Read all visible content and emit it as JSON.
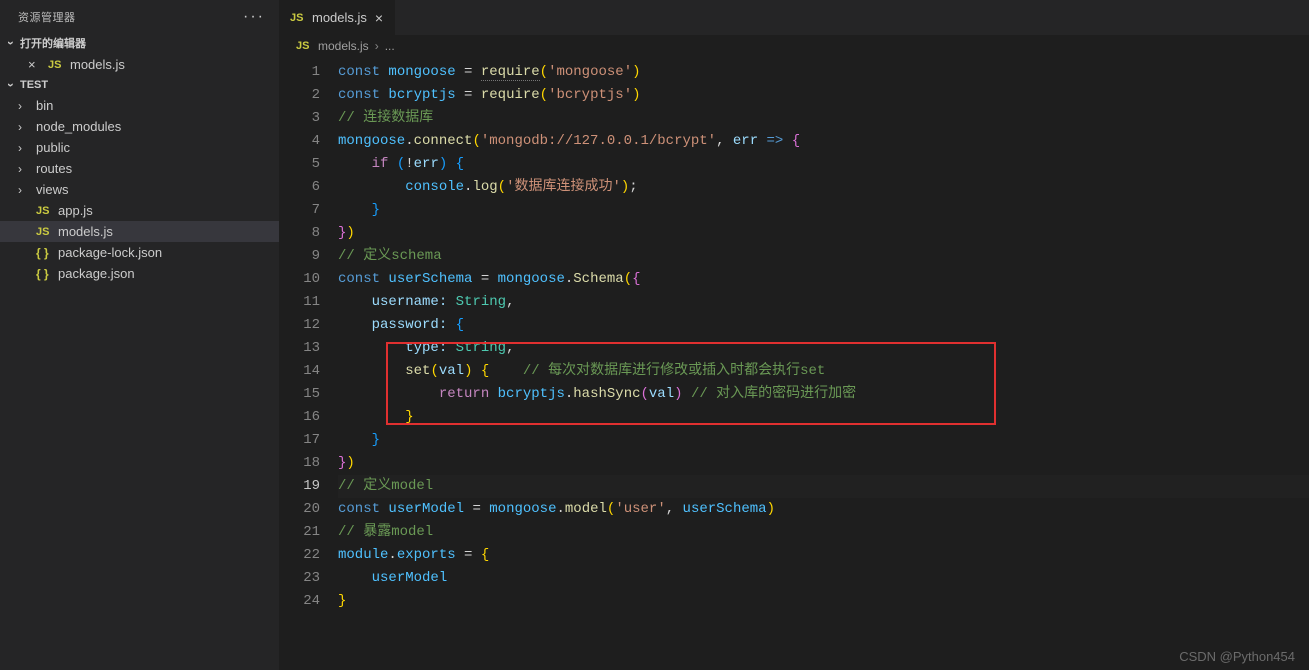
{
  "sidebar": {
    "title": "资源管理器",
    "open_editors_label": "打开的编辑器",
    "open_editors": [
      {
        "icon": "JS",
        "name": "models.js"
      }
    ],
    "root_label": "TEST",
    "tree": [
      {
        "type": "folder",
        "name": "bin"
      },
      {
        "type": "folder",
        "name": "node_modules"
      },
      {
        "type": "folder",
        "name": "public"
      },
      {
        "type": "folder",
        "name": "routes"
      },
      {
        "type": "folder",
        "name": "views"
      },
      {
        "type": "file",
        "icon": "JS",
        "name": "app.js"
      },
      {
        "type": "file",
        "icon": "JS",
        "name": "models.js",
        "active": true
      },
      {
        "type": "file",
        "icon": "{}",
        "name": "package-lock.json"
      },
      {
        "type": "file",
        "icon": "{}",
        "name": "package.json"
      }
    ]
  },
  "tab": {
    "icon": "JS",
    "name": "models.js"
  },
  "breadcrumb": {
    "icon": "JS",
    "file": "models.js",
    "dots": "..."
  },
  "code": {
    "lines": [
      [
        {
          "t": "const ",
          "c": "k-const"
        },
        {
          "t": "mongoose",
          "c": "k-var"
        },
        {
          "t": " = ",
          "c": "k-punc"
        },
        {
          "t": "require",
          "c": "k-func dotted"
        },
        {
          "t": "(",
          "c": "k-brace-y"
        },
        {
          "t": "'mongoose'",
          "c": "k-str"
        },
        {
          "t": ")",
          "c": "k-brace-y"
        }
      ],
      [
        {
          "t": "const ",
          "c": "k-const"
        },
        {
          "t": "bcryptjs",
          "c": "k-var"
        },
        {
          "t": " = ",
          "c": "k-punc"
        },
        {
          "t": "require",
          "c": "k-func"
        },
        {
          "t": "(",
          "c": "k-brace-y"
        },
        {
          "t": "'bcryptjs'",
          "c": "k-str"
        },
        {
          "t": ")",
          "c": "k-brace-y"
        }
      ],
      [
        {
          "t": "// 连接数据库",
          "c": "k-comment"
        }
      ],
      [
        {
          "t": "mongoose",
          "c": "k-var"
        },
        {
          "t": ".",
          "c": "k-punc"
        },
        {
          "t": "connect",
          "c": "k-func"
        },
        {
          "t": "(",
          "c": "k-brace-y"
        },
        {
          "t": "'mongodb://127.0.0.1/bcrypt'",
          "c": "k-str"
        },
        {
          "t": ", ",
          "c": "k-punc"
        },
        {
          "t": "err",
          "c": "k-var2"
        },
        {
          "t": " ",
          "c": "k-punc"
        },
        {
          "t": "=>",
          "c": "k-const"
        },
        {
          "t": " ",
          "c": "k-punc"
        },
        {
          "t": "{",
          "c": "k-brace-p"
        }
      ],
      [
        {
          "t": "    ",
          "c": ""
        },
        {
          "t": "if",
          "c": "k-keyword"
        },
        {
          "t": " ",
          "c": "k-punc"
        },
        {
          "t": "(",
          "c": "k-brace-b"
        },
        {
          "t": "!",
          "c": "k-punc"
        },
        {
          "t": "err",
          "c": "k-var2"
        },
        {
          "t": ")",
          "c": "k-brace-b"
        },
        {
          "t": " ",
          "c": "k-punc"
        },
        {
          "t": "{",
          "c": "k-brace-b"
        }
      ],
      [
        {
          "t": "        ",
          "c": ""
        },
        {
          "t": "console",
          "c": "k-var"
        },
        {
          "t": ".",
          "c": "k-punc"
        },
        {
          "t": "log",
          "c": "k-func"
        },
        {
          "t": "(",
          "c": "k-brace-y"
        },
        {
          "t": "'数据库连接成功'",
          "c": "k-str"
        },
        {
          "t": ")",
          "c": "k-brace-y"
        },
        {
          "t": ";",
          "c": "k-punc"
        }
      ],
      [
        {
          "t": "    ",
          "c": ""
        },
        {
          "t": "}",
          "c": "k-brace-b"
        }
      ],
      [
        {
          "t": "}",
          "c": "k-brace-p"
        },
        {
          "t": ")",
          "c": "k-brace-y"
        }
      ],
      [
        {
          "t": "// 定义schema",
          "c": "k-comment"
        }
      ],
      [
        {
          "t": "const ",
          "c": "k-const"
        },
        {
          "t": "userSchema",
          "c": "k-var"
        },
        {
          "t": " = ",
          "c": "k-punc"
        },
        {
          "t": "mongoose",
          "c": "k-var"
        },
        {
          "t": ".",
          "c": "k-punc"
        },
        {
          "t": "Schema",
          "c": "k-func"
        },
        {
          "t": "(",
          "c": "k-brace-y"
        },
        {
          "t": "{",
          "c": "k-brace-p"
        }
      ],
      [
        {
          "t": "    ",
          "c": ""
        },
        {
          "t": "username:",
          "c": "k-prop"
        },
        {
          "t": " ",
          "c": "k-punc"
        },
        {
          "t": "String",
          "c": "k-type"
        },
        {
          "t": ",",
          "c": "k-punc"
        }
      ],
      [
        {
          "t": "    ",
          "c": ""
        },
        {
          "t": "password:",
          "c": "k-prop"
        },
        {
          "t": " ",
          "c": "k-punc"
        },
        {
          "t": "{",
          "c": "k-brace-b"
        }
      ],
      [
        {
          "t": "        ",
          "c": ""
        },
        {
          "t": "type:",
          "c": "k-prop"
        },
        {
          "t": " ",
          "c": "k-punc"
        },
        {
          "t": "String",
          "c": "k-type"
        },
        {
          "t": ",",
          "c": "k-punc"
        }
      ],
      [
        {
          "t": "        ",
          "c": ""
        },
        {
          "t": "set",
          "c": "k-func"
        },
        {
          "t": "(",
          "c": "k-brace-y"
        },
        {
          "t": "val",
          "c": "k-var2"
        },
        {
          "t": ")",
          "c": "k-brace-y"
        },
        {
          "t": " ",
          "c": "k-punc"
        },
        {
          "t": "{",
          "c": "k-brace-y"
        },
        {
          "t": "    ",
          "c": ""
        },
        {
          "t": "// 每次对数据库进行修改或插入时都会执行set",
          "c": "k-comment"
        }
      ],
      [
        {
          "t": "            ",
          "c": ""
        },
        {
          "t": "return",
          "c": "k-keyword"
        },
        {
          "t": " ",
          "c": "k-punc"
        },
        {
          "t": "bcryptjs",
          "c": "k-var"
        },
        {
          "t": ".",
          "c": "k-punc"
        },
        {
          "t": "hashSync",
          "c": "k-func"
        },
        {
          "t": "(",
          "c": "k-brace-p"
        },
        {
          "t": "val",
          "c": "k-var2"
        },
        {
          "t": ")",
          "c": "k-brace-p"
        },
        {
          "t": " ",
          "c": "k-punc"
        },
        {
          "t": "// 对入库的密码进行加密",
          "c": "k-comment"
        }
      ],
      [
        {
          "t": "        ",
          "c": ""
        },
        {
          "t": "}",
          "c": "k-brace-y"
        }
      ],
      [
        {
          "t": "    ",
          "c": ""
        },
        {
          "t": "}",
          "c": "k-brace-b"
        }
      ],
      [
        {
          "t": "}",
          "c": "k-brace-p"
        },
        {
          "t": ")",
          "c": "k-brace-y"
        }
      ],
      [
        {
          "t": "// 定义model",
          "c": "k-comment"
        }
      ],
      [
        {
          "t": "const ",
          "c": "k-const"
        },
        {
          "t": "userModel",
          "c": "k-var"
        },
        {
          "t": " = ",
          "c": "k-punc"
        },
        {
          "t": "mongoose",
          "c": "k-var"
        },
        {
          "t": ".",
          "c": "k-punc"
        },
        {
          "t": "model",
          "c": "k-func"
        },
        {
          "t": "(",
          "c": "k-brace-y"
        },
        {
          "t": "'user'",
          "c": "k-str"
        },
        {
          "t": ", ",
          "c": "k-punc"
        },
        {
          "t": "userSchema",
          "c": "k-var"
        },
        {
          "t": ")",
          "c": "k-brace-y"
        }
      ],
      [
        {
          "t": "// 暴露model",
          "c": "k-comment"
        }
      ],
      [
        {
          "t": "module",
          "c": "k-var"
        },
        {
          "t": ".",
          "c": "k-punc"
        },
        {
          "t": "exports",
          "c": "k-var"
        },
        {
          "t": " = ",
          "c": "k-punc"
        },
        {
          "t": "{",
          "c": "k-brace-y"
        }
      ],
      [
        {
          "t": "    ",
          "c": ""
        },
        {
          "t": "userModel",
          "c": "k-var"
        }
      ],
      [
        {
          "t": "}",
          "c": "k-brace-y"
        }
      ]
    ],
    "current_line": 19
  },
  "watermark": "CSDN @Python454"
}
